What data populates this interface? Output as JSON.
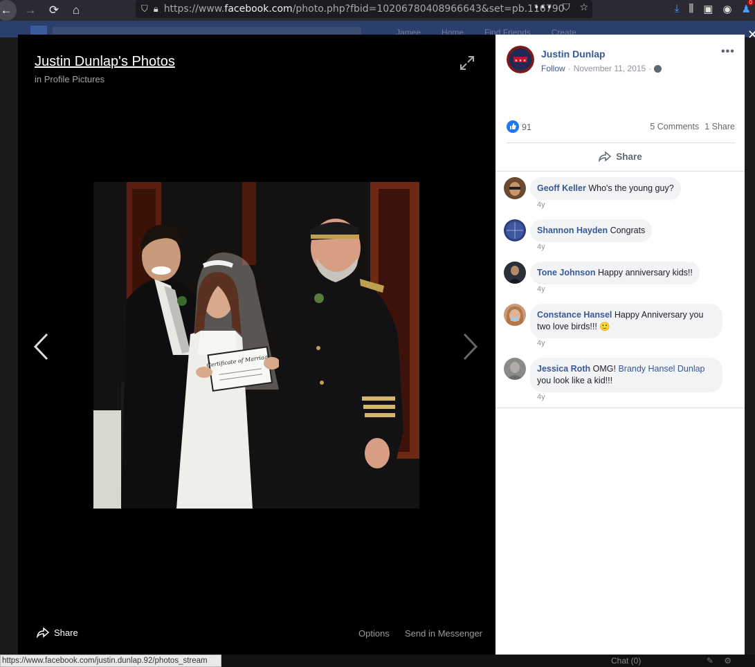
{
  "browser": {
    "url_prefix": "https://www.",
    "url_domain": "facebook.com",
    "url_suffix": "/photo.php?fbid=10206780408966643&set=pb.116790",
    "notification_count": "0",
    "status_url": "https://www.facebook.com/justin.dunlap.92/photos_stream"
  },
  "fb_header": {
    "nav": [
      "Jamee",
      "Home",
      "Find Friends",
      "Create"
    ]
  },
  "stage": {
    "album_title": "Justin Dunlap's Photos",
    "album_subtitle": "in Profile Pictures",
    "certificate_text": "Certificate of Marriage",
    "footer": {
      "share": "Share",
      "options": "Options",
      "send_messenger": "Send in Messenger"
    }
  },
  "post": {
    "author": "Justin Dunlap",
    "follow": "Follow",
    "separator": "·",
    "date": "November 11, 2015",
    "like_count": "91",
    "comments_count": "5 Comments",
    "shares_count": "1 Share",
    "share_label": "Share"
  },
  "comments": [
    {
      "author": "Geoff Keller",
      "text": "Who's the young guy?",
      "time": "4y",
      "avatar_color": "#6b4a2f"
    },
    {
      "author": "Shannon Hayden",
      "text": "Congrats",
      "time": "4y",
      "avatar_color": "#2d3f7a"
    },
    {
      "author": "Tone Johnson",
      "text": "Happy anniversary kids!!",
      "time": "4y",
      "avatar_color": "#2a2f3a"
    },
    {
      "author": "Constance Hansel",
      "text": "Happy Anniversary you two love birds!!! 🙂",
      "time": "4y",
      "avatar_color": "#c89a7a"
    },
    {
      "author": "Jessica Roth",
      "text_before": "OMG!",
      "mention": "Brandy Hansel Dunlap",
      "text_after": "you look like a kid!!!",
      "time": "4y",
      "avatar_color": "#8a8a88"
    }
  ],
  "chat": {
    "label": "Chat (0)"
  }
}
